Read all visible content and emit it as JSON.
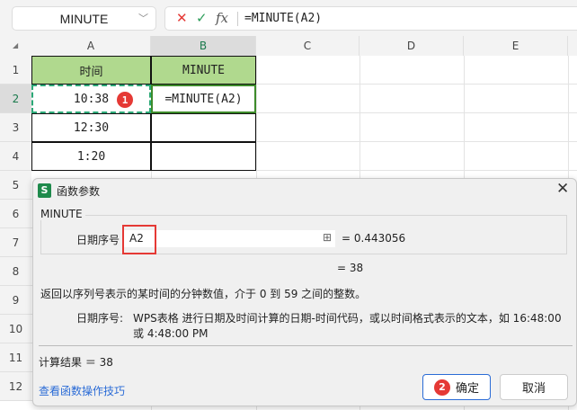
{
  "formula_bar": {
    "name_box": "MINUTE",
    "cancel_icon": "✕",
    "confirm_icon": "✓",
    "fx_icon": "fx",
    "formula": "=MINUTE(A2)"
  },
  "columns": [
    "A",
    "B",
    "C",
    "D",
    "E"
  ],
  "rows": [
    "1",
    "2",
    "3",
    "4",
    "5",
    "6",
    "7",
    "8",
    "9",
    "10",
    "11",
    "12"
  ],
  "cells": {
    "A1": "时间",
    "B1": "MINUTE",
    "A2": "10:38",
    "B2": "=MINUTE(A2)",
    "A3": "12:30",
    "A4": "1:20"
  },
  "badges": {
    "one": "1",
    "two": "2"
  },
  "dialog": {
    "title": "函数参数",
    "function_name": "MINUTE",
    "arg_label": "日期序号",
    "arg_value": "A2",
    "arg_result": "= 0.443056",
    "result_line": "= 38",
    "description": "返回以序列号表示的某时间的分钟数值，介于 0 到 59 之间的整数。",
    "param_name": "日期序号:",
    "param_desc_1": "WPS表格 进行日期及时间计算的日期-时间代码，或以时间格式表示的文本，如 16:48:00",
    "param_desc_2": "或 4:48:00 PM",
    "calc_result": "计算结果 ＝ 38",
    "help_link": "查看函数操作技巧",
    "ok": "确定",
    "cancel": "取消"
  },
  "colors": {
    "header_green": "#b0d98e",
    "selection_green": "#3d8b2a",
    "accent_red": "#e53935",
    "link_blue": "#2a6bd6"
  }
}
